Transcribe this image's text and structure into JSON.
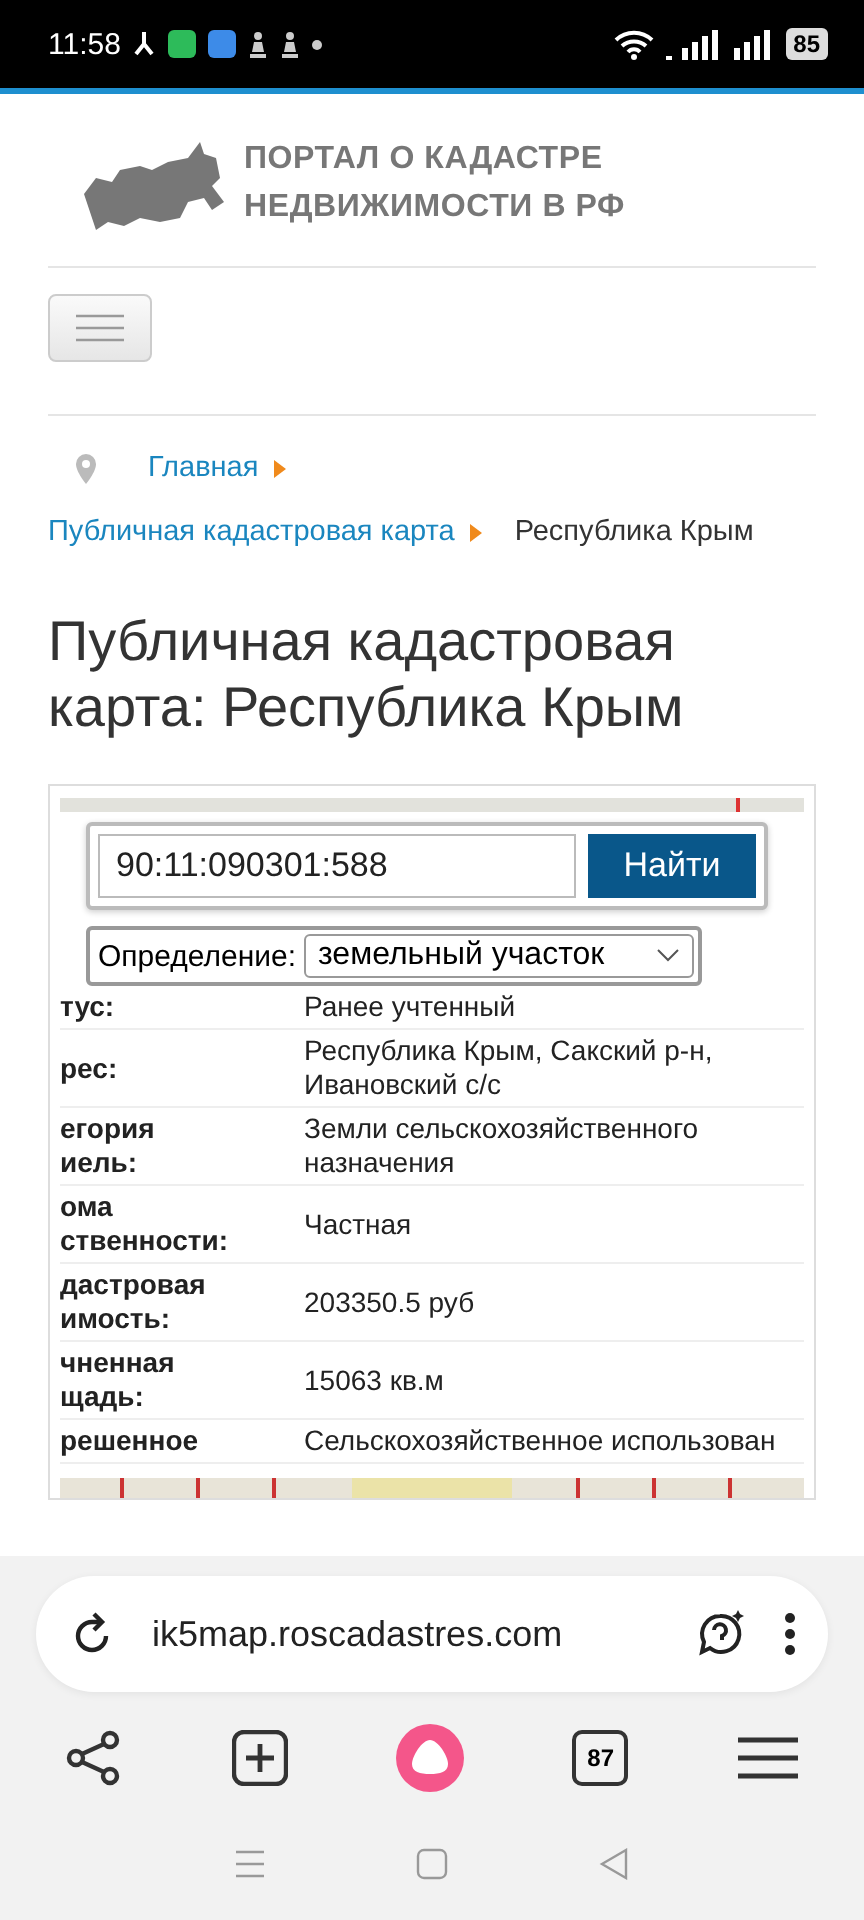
{
  "status_bar": {
    "time": "11:58",
    "battery": "85"
  },
  "header": {
    "logo_lines": [
      "ПОРТАЛ О КАДАСТРЕ",
      "НЕДВИЖИМОСТИ В РФ"
    ]
  },
  "breadcrumbs": [
    {
      "label": "Главная",
      "kind": "link"
    },
    {
      "label": "Публичная кадастровая карта",
      "kind": "link"
    },
    {
      "label": "Республика Крым",
      "kind": "current"
    }
  ],
  "title": "Публичная кадастровая карта: Республика Крым",
  "map_widget": {
    "search": {
      "value": "90:11:090301:588",
      "button": "Найти"
    },
    "definition": {
      "label": "Определение:",
      "value": "земельный участок"
    },
    "rows": [
      {
        "label": "тус:",
        "value": "Ранее учтенный"
      },
      {
        "label": "рес:",
        "value": "Республика Крым, Сакский р-н, Ивановский с/с"
      },
      {
        "label": "егория\nиель:",
        "value": "Земли сельскохозяйственного назначения"
      },
      {
        "label": "ома\nственности:",
        "value": "Частная"
      },
      {
        "label": "дастровая\nимость:",
        "value": "203350.5 руб"
      },
      {
        "label": "чненная\nщадь:",
        "value": "15063 кв.м"
      },
      {
        "label": "решенное",
        "value": "Сельскохозяйственное использован"
      }
    ]
  },
  "browser": {
    "url": "ik5map.roscadastres.com",
    "tabs_count": "87"
  }
}
